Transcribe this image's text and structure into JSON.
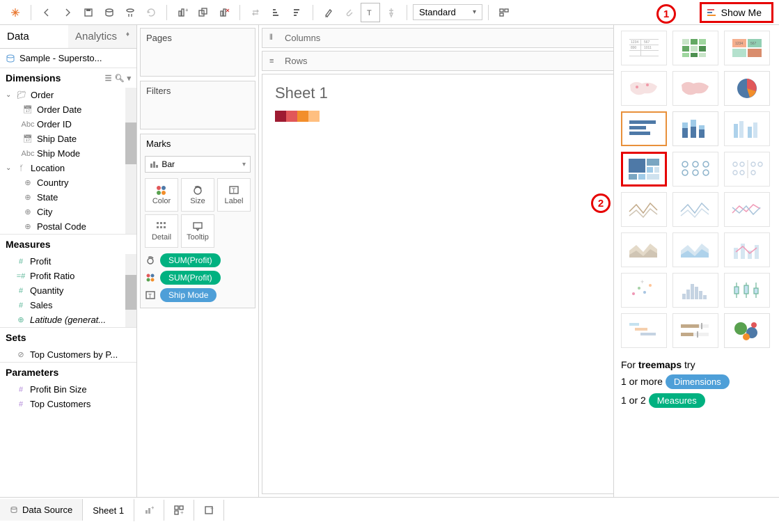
{
  "toolbar": {
    "fit_mode": "Standard",
    "show_me_label": "Show Me"
  },
  "sidebar": {
    "tabs": {
      "data": "Data",
      "analytics": "Analytics"
    },
    "data_source": "Sample - Supersto...",
    "dimensions_header": "Dimensions",
    "dimensions": {
      "group1": "Order",
      "g1_items": [
        "Order Date",
        "Order ID",
        "Ship Date",
        "Ship Mode"
      ],
      "group2": "Location",
      "g2_items": [
        "Country",
        "State",
        "City",
        "Postal Code"
      ]
    },
    "measures_header": "Measures",
    "measures": [
      "Profit",
      "Profit Ratio",
      "Quantity",
      "Sales",
      "Latitude (generat..."
    ],
    "sets_header": "Sets",
    "sets": [
      "Top Customers by P..."
    ],
    "params_header": "Parameters",
    "params": [
      "Profit Bin Size",
      "Top Customers"
    ]
  },
  "shelves": {
    "pages": "Pages",
    "filters": "Filters",
    "marks": "Marks",
    "mark_type": "Bar",
    "cells": {
      "color": "Color",
      "size": "Size",
      "label": "Label",
      "detail": "Detail",
      "tooltip": "Tooltip"
    },
    "pills": {
      "p1": "SUM(Profit)",
      "p2": "SUM(Profit)",
      "p3": "Ship Mode"
    }
  },
  "canvas": {
    "columns_label": "Columns",
    "rows_label": "Rows",
    "sheet_title": "Sheet 1"
  },
  "showme": {
    "hint_prefix": "For ",
    "hint_bold": "treemaps",
    "hint_suffix": " try",
    "line1_prefix": "1 or more ",
    "line1_tag": "Dimensions",
    "line2_prefix": "1 or 2 ",
    "line2_tag": "Measures"
  },
  "bottom": {
    "data_source": "Data Source",
    "sheet": "Sheet 1"
  },
  "annotations": {
    "a1": "1",
    "a2": "2"
  }
}
